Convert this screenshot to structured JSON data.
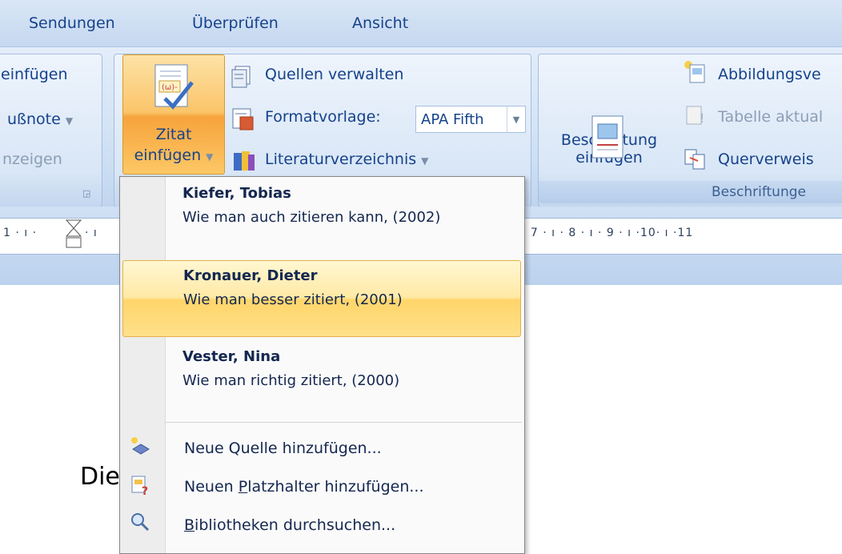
{
  "tabs": [
    "Sendungen",
    "Überprüfen",
    "Ansicht"
  ],
  "ribbon": {
    "left_group": {
      "items": [
        "einfügen",
        "ußnote",
        "nzeigen"
      ]
    },
    "citations_group": {
      "insert_citation_line1": "Zitat",
      "insert_citation_line2": "einfügen",
      "manage_sources": "Quellen verwalten",
      "style_label": "Formatvorlage:",
      "style_value": "APA Fifth",
      "bibliography": "Literaturverzeichnis"
    },
    "captions_group": {
      "insert_caption_line1": "Beschriftung",
      "insert_caption_line2": "einfügen",
      "table_of_figures": "Abbildungsve",
      "update_table": "Tabelle aktual",
      "cross_reference": "Querverweis",
      "label": "Beschriftunge"
    }
  },
  "ruler": {
    "left": "1 · ı ·",
    "left2": "· ı",
    "right": "· 7 · ı · 8 · ı · 9 · ı ·10· ı ·11"
  },
  "document": {
    "text": "Die"
  },
  "menu": {
    "citations": [
      {
        "author": "Kiefer, Tobias",
        "title": "Wie man auch zitieren kann, (2002)"
      },
      {
        "author": "Kronauer, Dieter",
        "title": "Wie man besser zitiert, (2001)"
      },
      {
        "author": "Vester, Nina",
        "title": "Wie man richtig zitiert, (2000)"
      }
    ],
    "commands": {
      "add_source": "Neue Quelle hinzufügen...",
      "add_placeholder_pre": "Neuen ",
      "add_placeholder_u": "P",
      "add_placeholder_post": "latzhalter hinzufügen...",
      "search_lib_u": "B",
      "search_lib_post": "ibliotheken durchsuchen..."
    }
  },
  "colors": {
    "ribbon_text": "#15428b",
    "highlight": "#ffd56a",
    "tab_bg": "#d9e6f6"
  }
}
